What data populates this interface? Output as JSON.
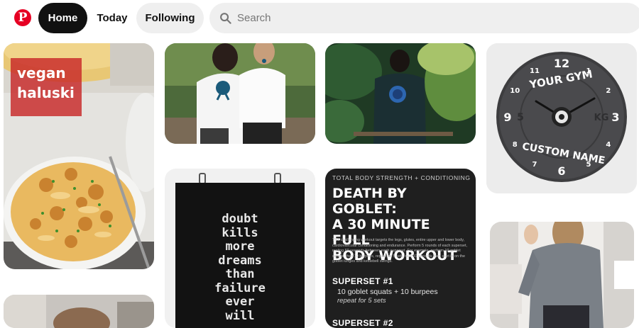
{
  "header": {
    "logo_glyph": "P",
    "nav": {
      "home": "Home",
      "today": "Today",
      "following": "Following"
    },
    "search": {
      "placeholder": "Search",
      "value": ""
    }
  },
  "colors": {
    "brand": "#e60023",
    "active_nav_bg": "#111111",
    "nav_bg": "#efefef"
  },
  "pins": {
    "vegan": {
      "label_line1": "vegan",
      "label_line2": "haluski"
    },
    "clock": {
      "numerals": [
        "12",
        "1",
        "2",
        "3",
        "4",
        "5",
        "6",
        "7",
        "8",
        "9",
        "10",
        "11"
      ],
      "top_text": "YOUR GYM",
      "bottom_text": "CUSTOM NAME",
      "weight_left": "5",
      "weight_right": "KG"
    },
    "poster": {
      "lines": [
        "doubt",
        "kills",
        "more",
        "dreams",
        "than",
        "failure",
        "ever",
        "will"
      ]
    },
    "workout": {
      "eyebrow": "TOTAL BODY STRENGTH + CONDITIONING",
      "title_line1": "DEATH BY GOBLET:",
      "title_line2": "A 30 MINUTE FULL",
      "title_line3": "BODY WORKOUT",
      "body": "This challenging workout targets the legs, glutes, entire upper and lower body, cardiovascular conditioning and endurance. Perform 5 rounds of each superset, resting 60 seconds between each superset. For example, perform 10 goblet squats, then 10 burpees, repeat for 5 sets, rest 60 seconds then start in on the goblet lunges and kettlebell swings.",
      "superset1_title": "SUPERSET #1",
      "superset1_line": "10 goblet squats + 10 burpees",
      "superset1_repeat": "repeat for 5 sets",
      "superset2_title": "SUPERSET #2"
    }
  }
}
